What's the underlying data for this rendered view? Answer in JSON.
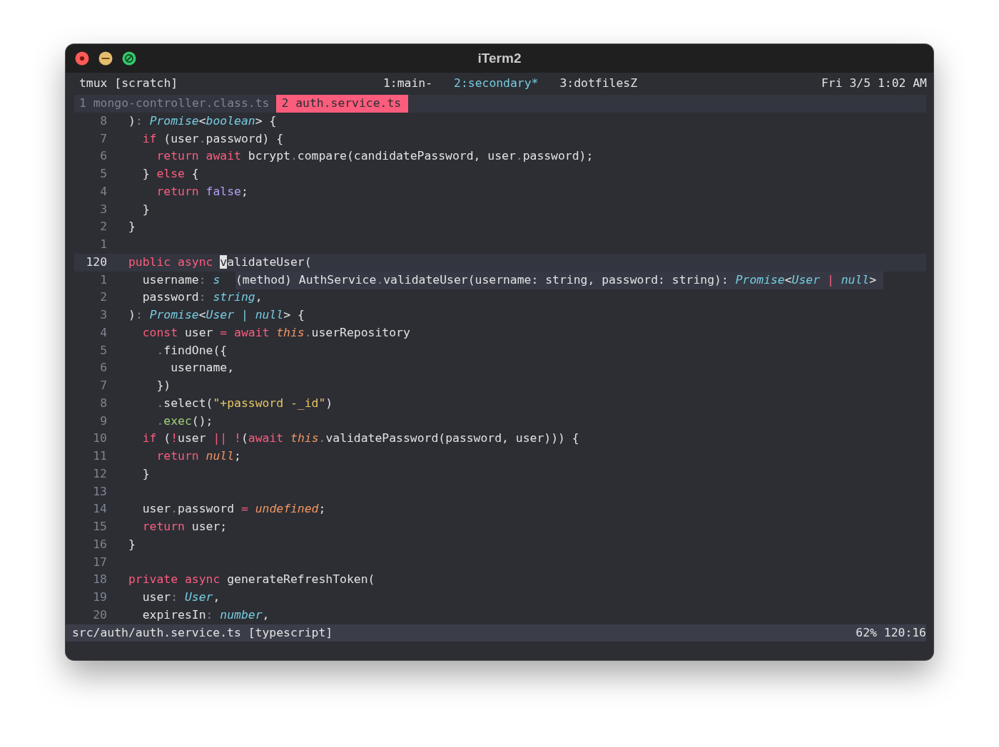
{
  "window": {
    "title": "iTerm2"
  },
  "tmux": {
    "session": "tmux [scratch]",
    "windows": [
      {
        "label": "1:main-",
        "selected": false
      },
      {
        "label": "2:secondary*",
        "selected": true
      },
      {
        "label": "3:dotfilesZ",
        "selected": false
      }
    ],
    "clock": "Fri 3/5 1:02 AM"
  },
  "buffer_tabs": [
    {
      "label": "1 mongo-controller.class.ts",
      "selected": false
    },
    {
      "label": "2 auth.service.ts",
      "selected": true
    }
  ],
  "editor": {
    "lines": [
      {
        "number": "8",
        "current": false,
        "tokens": [
          {
            "kind": "plain",
            "text": ")"
          },
          {
            "kind": "punct",
            "text": ": "
          },
          {
            "kind": "type",
            "text": "Promise"
          },
          {
            "kind": "plain",
            "text": "<"
          },
          {
            "kind": "type",
            "text": "boolean"
          },
          {
            "kind": "plain",
            "text": "> {"
          }
        ]
      },
      {
        "number": "7",
        "current": false,
        "tokens": [
          {
            "kind": "keyword",
            "text": "  if"
          },
          {
            "kind": "plain",
            "text": " (user"
          },
          {
            "kind": "punct",
            "text": "."
          },
          {
            "kind": "plain",
            "text": "password) {"
          }
        ]
      },
      {
        "number": "6",
        "current": false,
        "tokens": [
          {
            "kind": "keyword",
            "text": "    return await"
          },
          {
            "kind": "plain",
            "text": " bcrypt"
          },
          {
            "kind": "punct",
            "text": "."
          },
          {
            "kind": "plain",
            "text": "compare(candidatePassword, user"
          },
          {
            "kind": "punct",
            "text": "."
          },
          {
            "kind": "plain",
            "text": "password);"
          }
        ]
      },
      {
        "number": "5",
        "current": false,
        "tokens": [
          {
            "kind": "plain",
            "text": "  } "
          },
          {
            "kind": "keyword",
            "text": "else"
          },
          {
            "kind": "plain",
            "text": " {"
          }
        ]
      },
      {
        "number": "4",
        "current": false,
        "tokens": [
          {
            "kind": "keyword",
            "text": "    return "
          },
          {
            "kind": "boolean",
            "text": "false"
          },
          {
            "kind": "plain",
            "text": ";"
          }
        ]
      },
      {
        "number": "3",
        "current": false,
        "tokens": [
          {
            "kind": "plain",
            "text": "  }"
          }
        ]
      },
      {
        "number": "2",
        "current": false,
        "tokens": [
          {
            "kind": "plain",
            "text": "}"
          }
        ]
      },
      {
        "number": "1",
        "current": false
      },
      {
        "number": "120",
        "current": true,
        "tokens": [
          {
            "kind": "keyword",
            "text": "public async "
          },
          {
            "kind": "cursor",
            "text": "v"
          },
          {
            "kind": "plain",
            "text": "alidateUser("
          }
        ]
      },
      {
        "number": "1",
        "current": false,
        "tokens": [
          {
            "kind": "plain",
            "text": "  username"
          },
          {
            "kind": "punct",
            "text": ": "
          },
          {
            "kind": "type",
            "text": "s"
          }
        ]
      },
      {
        "number": "2",
        "current": false,
        "tokens": [
          {
            "kind": "plain",
            "text": "  password"
          },
          {
            "kind": "punct",
            "text": ": "
          },
          {
            "kind": "type",
            "text": "string"
          },
          {
            "kind": "plain",
            "text": ","
          }
        ]
      },
      {
        "number": "3",
        "current": false,
        "tokens": [
          {
            "kind": "plain",
            "text": ")"
          },
          {
            "kind": "punct",
            "text": ": "
          },
          {
            "kind": "type",
            "text": "Promise"
          },
          {
            "kind": "plain",
            "text": "<"
          },
          {
            "kind": "type",
            "text": "User | null"
          },
          {
            "kind": "plain",
            "text": "> {"
          }
        ]
      },
      {
        "number": "4",
        "current": false,
        "tokens": [
          {
            "kind": "keyword",
            "text": "  const"
          },
          {
            "kind": "plain",
            "text": " user "
          },
          {
            "kind": "keyword",
            "text": "= await "
          },
          {
            "kind": "constant",
            "text": "this"
          },
          {
            "kind": "punct",
            "text": "."
          },
          {
            "kind": "plain",
            "text": "userRepository"
          }
        ]
      },
      {
        "number": "5",
        "current": false,
        "tokens": [
          {
            "kind": "punct",
            "text": "    ."
          },
          {
            "kind": "plain",
            "text": "findOne({"
          }
        ]
      },
      {
        "number": "6",
        "current": false,
        "tokens": [
          {
            "kind": "plain",
            "text": "      username,"
          }
        ]
      },
      {
        "number": "7",
        "current": false,
        "tokens": [
          {
            "kind": "plain",
            "text": "    })"
          }
        ]
      },
      {
        "number": "8",
        "current": false,
        "tokens": [
          {
            "kind": "punct",
            "text": "    ."
          },
          {
            "kind": "plain",
            "text": "select("
          },
          {
            "kind": "string",
            "text": "\"+password -_id\""
          },
          {
            "kind": "plain",
            "text": ")"
          }
        ]
      },
      {
        "number": "9",
        "current": false,
        "tokens": [
          {
            "kind": "punct",
            "text": "    ."
          },
          {
            "kind": "builtin",
            "text": "exec"
          },
          {
            "kind": "plain",
            "text": "();"
          }
        ]
      },
      {
        "number": "10",
        "current": false,
        "tokens": [
          {
            "kind": "keyword",
            "text": "  if"
          },
          {
            "kind": "plain",
            "text": " ("
          },
          {
            "kind": "keyword",
            "text": "!"
          },
          {
            "kind": "plain",
            "text": "user "
          },
          {
            "kind": "keyword",
            "text": "|| !"
          },
          {
            "kind": "plain",
            "text": "("
          },
          {
            "kind": "keyword",
            "text": "await "
          },
          {
            "kind": "constant",
            "text": "this"
          },
          {
            "kind": "punct",
            "text": "."
          },
          {
            "kind": "plain",
            "text": "validatePassword(password, user))) {"
          }
        ]
      },
      {
        "number": "11",
        "current": false,
        "tokens": [
          {
            "kind": "keyword",
            "text": "    return "
          },
          {
            "kind": "constant",
            "text": "null"
          },
          {
            "kind": "plain",
            "text": ";"
          }
        ]
      },
      {
        "number": "12",
        "current": false,
        "tokens": [
          {
            "kind": "plain",
            "text": "  }"
          }
        ]
      },
      {
        "number": "13",
        "current": false
      },
      {
        "number": "14",
        "current": false,
        "tokens": [
          {
            "kind": "plain",
            "text": "  user"
          },
          {
            "kind": "punct",
            "text": "."
          },
          {
            "kind": "plain",
            "text": "password "
          },
          {
            "kind": "keyword",
            "text": "= "
          },
          {
            "kind": "constant",
            "text": "undefined"
          },
          {
            "kind": "plain",
            "text": ";"
          }
        ]
      },
      {
        "number": "15",
        "current": false,
        "tokens": [
          {
            "kind": "keyword",
            "text": "  return"
          },
          {
            "kind": "plain",
            "text": " user;"
          }
        ]
      },
      {
        "number": "16",
        "current": false,
        "tokens": [
          {
            "kind": "plain",
            "text": "}"
          }
        ]
      },
      {
        "number": "17",
        "current": false
      },
      {
        "number": "18",
        "current": false,
        "tokens": [
          {
            "kind": "keyword",
            "text": "private async"
          },
          {
            "kind": "plain",
            "text": " generateRefreshToken("
          }
        ]
      },
      {
        "number": "19",
        "current": false,
        "tokens": [
          {
            "kind": "plain",
            "text": "  user"
          },
          {
            "kind": "punct",
            "text": ": "
          },
          {
            "kind": "type",
            "text": "User"
          },
          {
            "kind": "plain",
            "text": ","
          }
        ]
      },
      {
        "number": "20",
        "current": false,
        "tokens": [
          {
            "kind": "plain",
            "text": "  expiresIn"
          },
          {
            "kind": "punct",
            "text": ": "
          },
          {
            "kind": "type",
            "text": "number"
          },
          {
            "kind": "plain",
            "text": ","
          }
        ]
      }
    ],
    "hover": {
      "tokens": [
        {
          "kind": "plain",
          "text": "(method) AuthService"
        },
        {
          "kind": "punct",
          "text": "."
        },
        {
          "kind": "plain",
          "text": "validateUser(username: string, password: string): "
        },
        {
          "kind": "type",
          "text": "Promise"
        },
        {
          "kind": "plain",
          "text": "<"
        },
        {
          "kind": "type",
          "text": "User "
        },
        {
          "kind": "keyword",
          "text": "| "
        },
        {
          "kind": "type",
          "text": "null"
        },
        {
          "kind": "plain",
          "text": ">"
        }
      ]
    }
  },
  "status_bar": {
    "file": "src/auth/auth.service.ts [typescript]",
    "position": "62% 120:16"
  }
}
